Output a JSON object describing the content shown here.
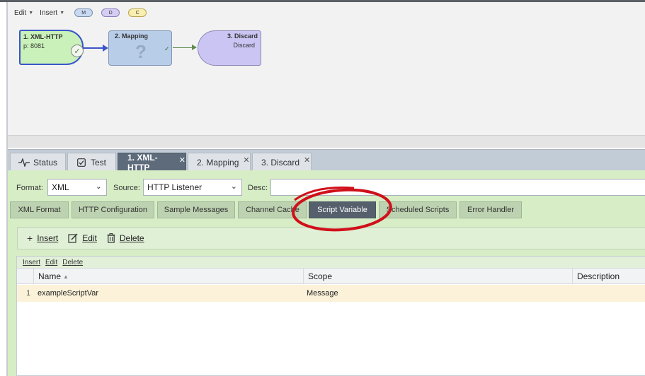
{
  "designer": {
    "menu_edit": "Edit",
    "menu_insert": "Insert",
    "pill_m": "M",
    "pill_d": "D",
    "pill_c": "C",
    "nodes": [
      {
        "title": "1. XML-HTTP",
        "sub": "p: 8081"
      },
      {
        "title": "2. Mapping",
        "glyph": "?"
      },
      {
        "title": "3. Discard",
        "sub": "Discard"
      }
    ]
  },
  "tabs": [
    {
      "label": "Status",
      "icon": "activity-icon"
    },
    {
      "label": "Test",
      "icon": "checkbox-icon"
    },
    {
      "label": "1. XML-HTTP",
      "closable": true,
      "active": true
    },
    {
      "label": "2. Mapping",
      "closable": true
    },
    {
      "label": "3. Discard",
      "closable": true
    }
  ],
  "form": {
    "format_label": "Format:",
    "format_value": "XML",
    "source_label": "Source:",
    "source_value": "HTTP Listener",
    "desc_label": "Desc:",
    "desc_value": ""
  },
  "subtabs": [
    "XML Format",
    "HTTP Configuration",
    "Sample Messages",
    "Channel Cache",
    "Script Variable",
    "Scheduled Scripts",
    "Error Handler"
  ],
  "actions": {
    "insert": "Insert",
    "edit": "Edit",
    "delete": "Delete"
  },
  "grid": {
    "menu": [
      "Insert",
      "Edit",
      "Delete"
    ],
    "columns": [
      "Name",
      "Scope",
      "Description"
    ],
    "rows": [
      {
        "num": "1",
        "name": "exampleScriptVar",
        "scope": "Message",
        "description": ""
      }
    ]
  },
  "colors": {
    "accent_active_tab": "#5d6b7b",
    "annotation": "#d0101a",
    "panel_green": "#d6edc6"
  }
}
